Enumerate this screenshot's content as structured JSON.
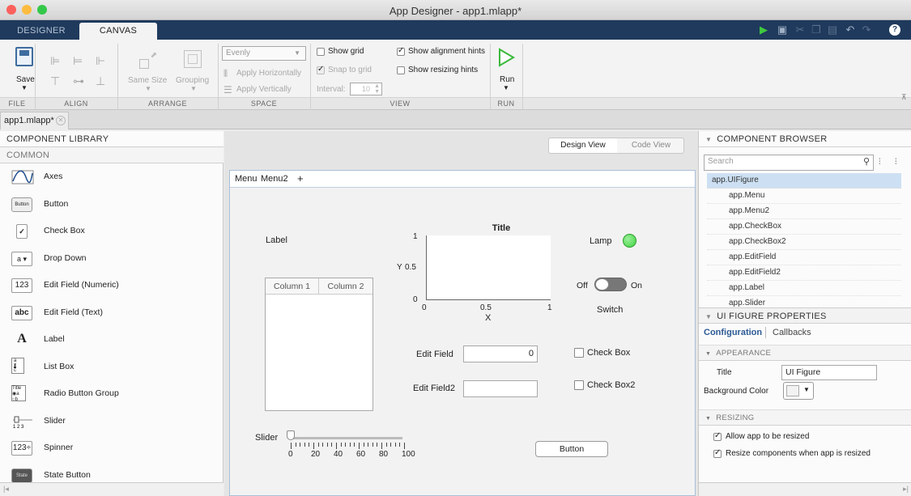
{
  "window": {
    "title": "App Designer - app1.mlapp*"
  },
  "toolstrip": {
    "tabs": [
      {
        "label": "DESIGNER"
      },
      {
        "label": "CANVAS"
      }
    ],
    "file": {
      "save_label": "Save",
      "section": "FILE"
    },
    "align": {
      "section": "ALIGN"
    },
    "arrange": {
      "same_size": "Same Size",
      "grouping": "Grouping",
      "section": "ARRANGE"
    },
    "space": {
      "dropdown_value": "Evenly",
      "apply_horizontally": "Apply Horizontally",
      "apply_vertically": "Apply Vertically",
      "section": "SPACE"
    },
    "view": {
      "show_grid": "Show grid",
      "snap_to_grid": "Snap to grid",
      "interval_label": "Interval:",
      "interval_value": "10",
      "show_alignment_hints": "Show alignment hints",
      "show_resizing_hints": "Show resizing hints",
      "section": "VIEW"
    },
    "run": {
      "label": "Run",
      "section": "RUN"
    }
  },
  "document": {
    "tab_label": "app1.mlapp*"
  },
  "library": {
    "header": "COMPONENT LIBRARY",
    "category": "COMMON",
    "items": [
      {
        "label": "Axes",
        "icon": "axes-icon",
        "glyph": ""
      },
      {
        "label": "Button",
        "icon": "button-icon",
        "glyph": "Button"
      },
      {
        "label": "Check Box",
        "icon": "checkbox-icon",
        "glyph": "✓"
      },
      {
        "label": "Drop Down",
        "icon": "dropdown-icon",
        "glyph": "a  ▾"
      },
      {
        "label": "Edit Field (Numeric)",
        "icon": "numeric-field-icon",
        "glyph": "123"
      },
      {
        "label": "Edit Field (Text)",
        "icon": "text-field-icon",
        "glyph": "abc"
      },
      {
        "label": "Label",
        "icon": "label-icon",
        "glyph": "A"
      },
      {
        "label": "List Box",
        "icon": "listbox-icon",
        "glyph": ""
      },
      {
        "label": "Radio Button Group",
        "icon": "radio-group-icon",
        "glyph": "Title"
      },
      {
        "label": "Slider",
        "icon": "slider-icon",
        "glyph": ""
      },
      {
        "label": "Spinner",
        "icon": "spinner-icon",
        "glyph": "123÷"
      },
      {
        "label": "State Button",
        "icon": "state-button-icon",
        "glyph": "State"
      }
    ]
  },
  "views": {
    "design": "Design View",
    "code": "Code View"
  },
  "figure": {
    "menus": [
      "Menu",
      "Menu2",
      "+"
    ],
    "label": "Label",
    "table_columns": [
      "Column 1",
      "Column 2"
    ],
    "axes": {
      "title": "Title",
      "xlabel": "X",
      "ylabel": "Y",
      "xticks": [
        "0",
        "0.5",
        "1"
      ],
      "yticks": [
        "0",
        "0.5",
        "1"
      ]
    },
    "lamp_label": "Lamp",
    "lamp_color": "#3fd43f",
    "switch": {
      "off": "Off",
      "on": "On",
      "label": "Switch"
    },
    "edit_field": {
      "label": "Edit Field",
      "value": "0"
    },
    "edit_field2": {
      "label": "Edit Field2",
      "value": ""
    },
    "checkbox": "Check Box",
    "checkbox2": "Check Box2",
    "slider": {
      "label": "Slider",
      "ticks": [
        "0",
        "20",
        "40",
        "60",
        "80",
        "100"
      ]
    },
    "button": "Button"
  },
  "browser": {
    "header": "COMPONENT BROWSER",
    "search_placeholder": "Search",
    "items": [
      "app.UIFigure",
      "app.Menu",
      "app.Menu2",
      "app.CheckBox",
      "app.CheckBox2",
      "app.EditField",
      "app.EditField2",
      "app.Label",
      "app.Slider"
    ]
  },
  "properties": {
    "header": "UI FIGURE PROPERTIES",
    "tabs": {
      "configuration": "Configuration",
      "callbacks": "Callbacks"
    },
    "appearance": "APPEARANCE",
    "title_label": "Title",
    "title_value": "UI Figure",
    "bg_label": "Background Color",
    "resizing": "RESIZING",
    "allow_resize": "Allow app to be resized",
    "resize_components": "Resize components when app is resized"
  }
}
